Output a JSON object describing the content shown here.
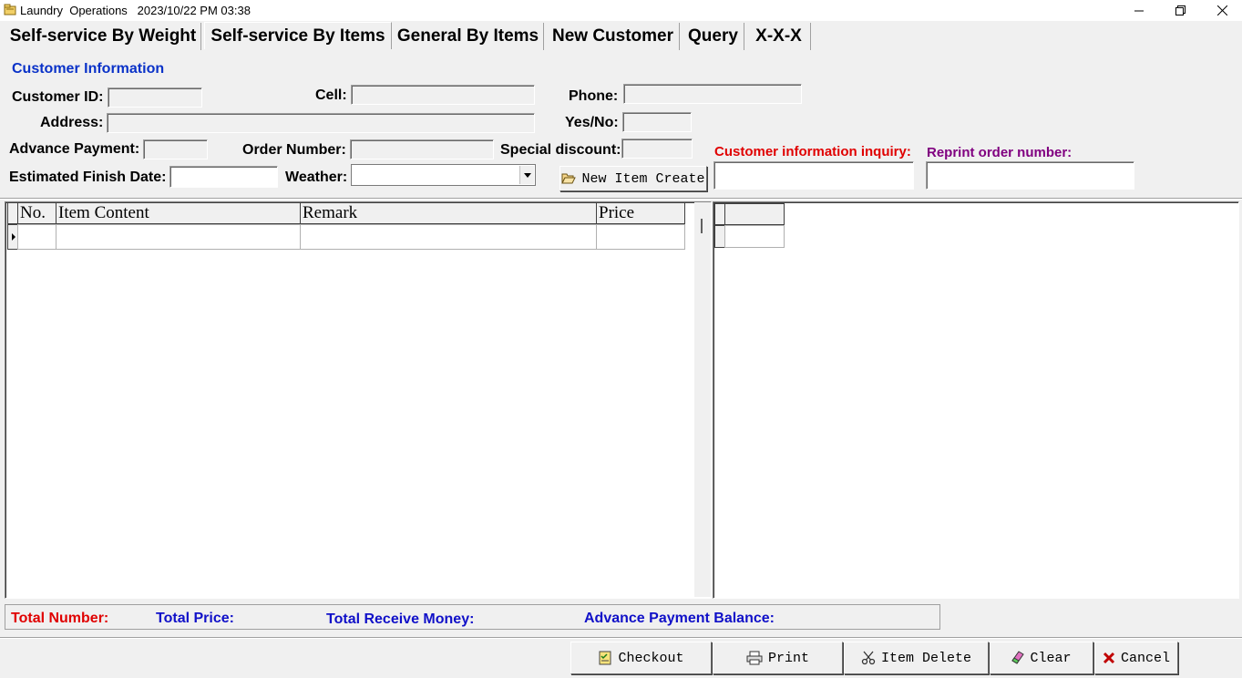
{
  "window": {
    "title": "Laundry  Operations   2023/10/22 PM 03:38",
    "controls": {
      "minimize": "─",
      "maximize": "❐",
      "close": "✕"
    }
  },
  "tabs": [
    {
      "label": "Self-service By Weight",
      "active": false
    },
    {
      "label": "Self-service By Items",
      "active": true
    },
    {
      "label": "General By Items",
      "active": false
    },
    {
      "label": "New Customer",
      "active": false
    },
    {
      "label": "Query",
      "active": false
    },
    {
      "label": "X-X-X",
      "active": false
    }
  ],
  "customer": {
    "section_title": "Customer Information",
    "customer_id_label": "Customer ID:",
    "cell_label": "Cell:",
    "phone_label": "Phone:",
    "address_label": "Address:",
    "yesno_label": "Yes/No:",
    "advance_payment_label": "Advance Payment:",
    "order_number_label": "Order Number:",
    "special_discount_label": "Special discount:",
    "estimated_finish_label": "Estimated Finish Date:",
    "weather_label": "Weather:",
    "inquiry_label": "Customer information inquiry:",
    "reprint_label": "Reprint order number:",
    "new_item_button": "New Item Create"
  },
  "items_grid": {
    "columns": [
      "No.",
      "Item Content",
      "Remark",
      "Price"
    ],
    "row_indicator": "▶"
  },
  "summary": {
    "total_number": "Total Number:",
    "total_price": "Total Price:",
    "total_receive": "Total Receive Money:",
    "advance_balance": "Advance Payment Balance:"
  },
  "actions": {
    "checkout": "Checkout",
    "print": "Print",
    "item_delete": "Item Delete",
    "clear": "Clear",
    "cancel": "Cancel"
  },
  "colors": {
    "red_label": "#e00000",
    "blue_label": "#1010c8",
    "purple_label": "#800080",
    "section_blue": "#0a32c8"
  }
}
